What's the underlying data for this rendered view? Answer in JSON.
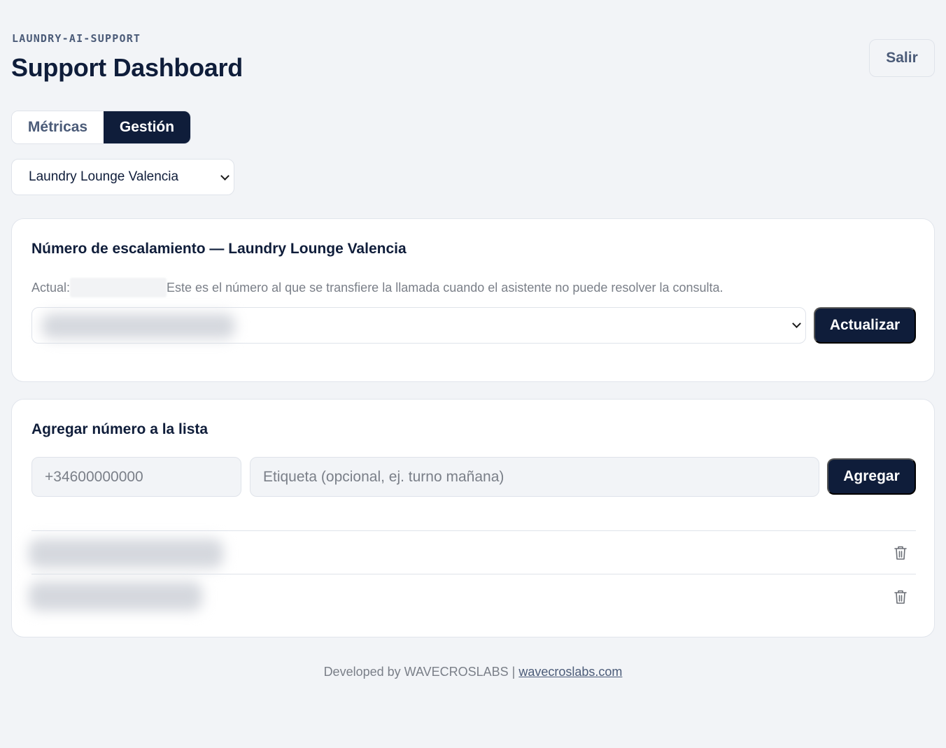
{
  "header": {
    "eyebrow": "LAUNDRY-AI-SUPPORT",
    "title": "Support Dashboard",
    "logout_label": "Salir"
  },
  "tabs": [
    {
      "label": "Métricas",
      "active": false
    },
    {
      "label": "Gestión",
      "active": true
    }
  ],
  "location_select": {
    "selected": "Laundry Lounge Valencia",
    "icon": "chevron-down-icon"
  },
  "escalation_card": {
    "title": "Número de escalamiento — Laundry Lounge Valencia",
    "current_label": "Actual:",
    "current_value_redacted": true,
    "description": "Este es el número al que se transfiere la llamada cuando el asistente no puede resolver la consulta.",
    "selected_number_redacted": true,
    "update_label": "Actualizar"
  },
  "add_card": {
    "title": "Agregar número a la lista",
    "phone_placeholder": "+34600000000",
    "label_placeholder": "Etiqueta (opcional, ej. turno mañana)",
    "add_label": "Agregar",
    "numbers": [
      {
        "value_redacted": true,
        "icon": "trash-icon"
      },
      {
        "value_redacted": true,
        "icon": "trash-icon"
      }
    ]
  },
  "footer": {
    "text": "Developed by WAVECROSLABS | ",
    "link_text": "wavecroslabs.com"
  },
  "colors": {
    "background": "#f2f4f7",
    "primary_dark": "#0f1d3a",
    "muted_text": "#7a7f88",
    "secondary_text": "#4b5b78",
    "border": "#dfe3ea"
  }
}
